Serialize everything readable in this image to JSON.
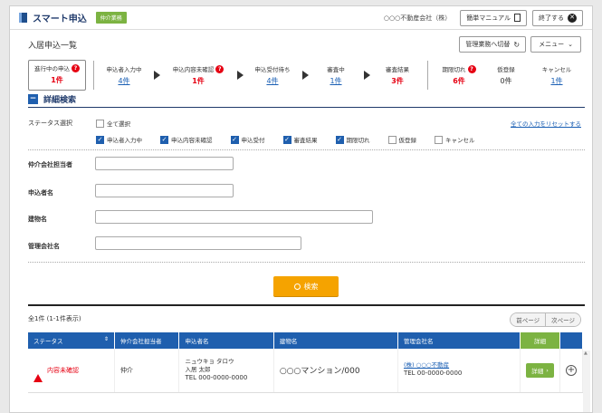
{
  "header": {
    "app_name": "スマート申込",
    "role_badge": "仲介業務",
    "company": "○○○不動産会社（株）",
    "manual_button": "簡単マニュアル",
    "exit_button": "終了する"
  },
  "page": {
    "title": "入居申込一覧",
    "switch_button": "管理業務へ切替",
    "menu_button": "メニュー"
  },
  "steps": [
    {
      "label": "進行中の申込",
      "count": "1件",
      "alert": "?",
      "style": "red"
    },
    {
      "label": "申込者入力中",
      "count": "4件",
      "style": "link"
    },
    {
      "label": "申込内容未確認",
      "count": "1件",
      "alert": "?",
      "style": "red"
    },
    {
      "label": "申込受付待ち",
      "count": "4件",
      "style": "link"
    },
    {
      "label": "審査中",
      "count": "1件",
      "style": "link"
    },
    {
      "label": "審査結果",
      "count": "3件",
      "style": "red"
    },
    {
      "label": "期限切れ",
      "count": "6件",
      "alert": "?",
      "style": "red"
    },
    {
      "label": "仮登録",
      "count": "0件",
      "style": "plain"
    },
    {
      "label": "キャンセル",
      "count": "1件",
      "style": "link"
    }
  ],
  "detail": {
    "title": "詳細検索",
    "status_label": "ステータス選択",
    "select_all": "全て選択",
    "reset_link": "全ての入力をリセットする",
    "checkboxes": [
      {
        "label": "申込者入力中",
        "checked": true
      },
      {
        "label": "申込内容未確認",
        "checked": true
      },
      {
        "label": "申込受付",
        "checked": true
      },
      {
        "label": "審査結果",
        "checked": true
      },
      {
        "label": "期限切れ",
        "checked": true
      },
      {
        "label": "仮登録",
        "checked": false
      },
      {
        "label": "キャンセル",
        "checked": false
      }
    ],
    "fields": {
      "agent": "仲介会社担当者",
      "applicant": "申込者名",
      "building": "建物名",
      "management": "管理会社名"
    },
    "search_button": "検索"
  },
  "results": {
    "summary": "全1件 (1-1件表示)",
    "prev": "前ページ",
    "next": "次ページ",
    "columns": [
      "ステータス",
      "仲介会社担当者",
      "申込者名",
      "建物名",
      "管理会社名",
      "詳細"
    ],
    "rows": [
      {
        "status": "内容未確認",
        "agent": "仲介",
        "applicant_kana": "ニュウキョ タロウ",
        "applicant_name": "入居 太郎",
        "applicant_tel": "TEL 000-0000-0000",
        "building": "○○○マンション/000",
        "management": "(株) ○○○不動産",
        "management_tel": "TEL 00-0000-0000",
        "detail_button": "詳細"
      }
    ]
  },
  "colors": {
    "primary": "#1f5fae",
    "accent_green": "#7cb342",
    "alert_red": "#e60012",
    "search_orange": "#f5a300"
  }
}
